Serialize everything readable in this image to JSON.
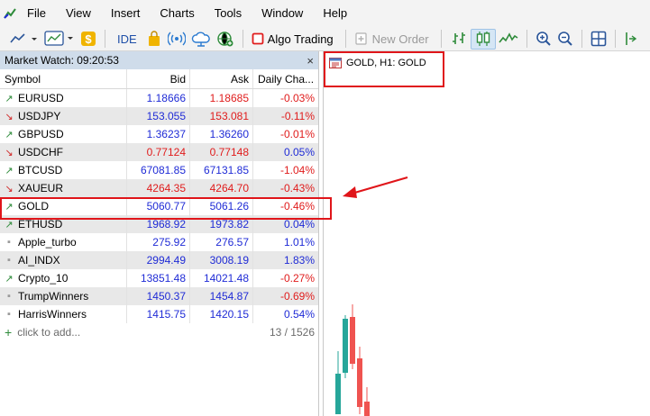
{
  "menu": [
    "File",
    "View",
    "Insert",
    "Charts",
    "Tools",
    "Window",
    "Help"
  ],
  "toolbar": {
    "ide_label": "IDE",
    "algo_label": "Algo Trading",
    "new_order_label": "New Order"
  },
  "market_watch": {
    "title": "Market Watch: 09:20:53",
    "close_glyph": "×",
    "columns": [
      "Symbol",
      "Bid",
      "Ask",
      "Daily Cha..."
    ],
    "rows": [
      {
        "symbol": "EURUSD",
        "bid": "1.18666",
        "ask": "1.18685",
        "change": "-0.03%",
        "dir": "up",
        "bid_color": "blue",
        "ask_color": "red",
        "chg_color": "red"
      },
      {
        "symbol": "USDJPY",
        "bid": "153.055",
        "ask": "153.081",
        "change": "-0.11%",
        "dir": "down",
        "bid_color": "blue",
        "ask_color": "red",
        "chg_color": "red"
      },
      {
        "symbol": "GBPUSD",
        "bid": "1.36237",
        "ask": "1.36260",
        "change": "-0.01%",
        "dir": "up",
        "bid_color": "blue",
        "ask_color": "blue",
        "chg_color": "red"
      },
      {
        "symbol": "USDCHF",
        "bid": "0.77124",
        "ask": "0.77148",
        "change": "0.05%",
        "dir": "down",
        "bid_color": "red",
        "ask_color": "red",
        "chg_color": "blue"
      },
      {
        "symbol": "BTCUSD",
        "bid": "67081.85",
        "ask": "67131.85",
        "change": "-1.04%",
        "dir": "up",
        "bid_color": "blue",
        "ask_color": "blue",
        "chg_color": "red"
      },
      {
        "symbol": "XAUEUR",
        "bid": "4264.35",
        "ask": "4264.70",
        "change": "-0.43%",
        "dir": "down",
        "bid_color": "red",
        "ask_color": "red",
        "chg_color": "red"
      },
      {
        "symbol": "GOLD",
        "bid": "5060.77",
        "ask": "5061.26",
        "change": "-0.46%",
        "dir": "up",
        "bid_color": "blue",
        "ask_color": "blue",
        "chg_color": "red"
      },
      {
        "symbol": "ETHUSD",
        "bid": "1968.92",
        "ask": "1973.82",
        "change": "0.04%",
        "dir": "up",
        "bid_color": "blue",
        "ask_color": "blue",
        "chg_color": "blue"
      },
      {
        "symbol": "Apple_turbo",
        "bid": "275.92",
        "ask": "276.57",
        "change": "1.01%",
        "dir": "none",
        "bid_color": "blue",
        "ask_color": "blue",
        "chg_color": "blue"
      },
      {
        "symbol": "AI_INDX",
        "bid": "2994.49",
        "ask": "3008.19",
        "change": "1.83%",
        "dir": "none",
        "bid_color": "blue",
        "ask_color": "blue",
        "chg_color": "blue"
      },
      {
        "symbol": "Crypto_10",
        "bid": "13851.48",
        "ask": "14021.48",
        "change": "-0.27%",
        "dir": "up",
        "bid_color": "blue",
        "ask_color": "blue",
        "chg_color": "red"
      },
      {
        "symbol": "TrumpWinners",
        "bid": "1450.37",
        "ask": "1454.87",
        "change": "-0.69%",
        "dir": "none",
        "bid_color": "blue",
        "ask_color": "blue",
        "chg_color": "red"
      },
      {
        "symbol": "HarrisWinners",
        "bid": "1415.75",
        "ask": "1420.15",
        "change": "0.54%",
        "dir": "none",
        "bid_color": "blue",
        "ask_color": "blue",
        "chg_color": "blue"
      }
    ],
    "add_label": "click to add...",
    "count": "13 / 1526"
  },
  "chart": {
    "title": "GOLD, H1:  GOLD"
  },
  "colors": {
    "up": "#2e8b3a",
    "down": "#d12a2a",
    "blue": "#1f2bd6",
    "red": "#e01c1c",
    "highlight": "#e0151a",
    "bull_candle": "#26a69a",
    "bear_candle": "#ef5350"
  }
}
